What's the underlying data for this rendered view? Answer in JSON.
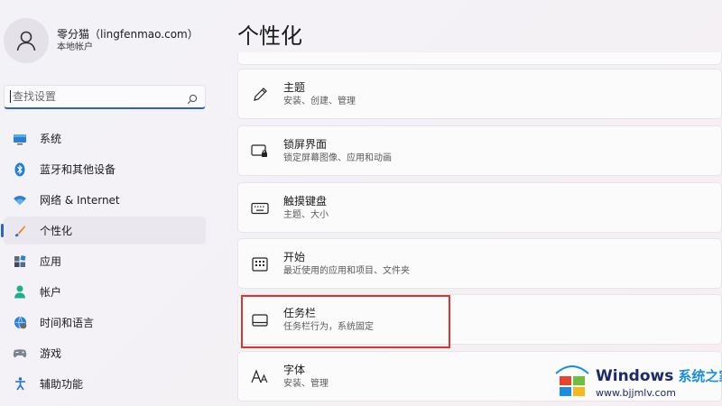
{
  "profile": {
    "name": "零分猫（lingfenmao.com）",
    "account_type": "本地帐户"
  },
  "search": {
    "placeholder": "查找设置"
  },
  "sidebar": {
    "items": [
      {
        "label": "系统",
        "icon": "monitor-icon"
      },
      {
        "label": "蓝牙和其他设备",
        "icon": "bluetooth-icon"
      },
      {
        "label": "网络 & Internet",
        "icon": "wifi-icon"
      },
      {
        "label": "个性化",
        "icon": "brush-icon",
        "active": true
      },
      {
        "label": "应用",
        "icon": "apps-icon"
      },
      {
        "label": "帐户",
        "icon": "person-icon"
      },
      {
        "label": "时间和语言",
        "icon": "globe-clock-icon"
      },
      {
        "label": "游戏",
        "icon": "gamepad-icon"
      },
      {
        "label": "辅助功能",
        "icon": "accessibility-icon"
      }
    ]
  },
  "page": {
    "title": "个性化"
  },
  "cards": [
    {
      "title": "主题",
      "subtitle": "安装、创建、管理",
      "icon": "pen-icon"
    },
    {
      "title": "锁屏界面",
      "subtitle": "锁定屏幕图像、应用和动画",
      "icon": "lock-screen-icon"
    },
    {
      "title": "触摸键盘",
      "subtitle": "主题、大小",
      "icon": "keyboard-icon"
    },
    {
      "title": "开始",
      "subtitle": "最近使用的应用和项目、文件夹",
      "icon": "start-menu-icon"
    },
    {
      "title": "任务栏",
      "subtitle": "任务栏行为，系统固定",
      "icon": "taskbar-icon",
      "highlighted": true
    },
    {
      "title": "字体",
      "subtitle": "安装、管理",
      "icon": "font-icon"
    }
  ],
  "watermark": {
    "brand": "Windows",
    "brand_cn": "系统之家",
    "url": "www.bjjmlv.com"
  },
  "colors": {
    "accent": "#2a63c6",
    "highlight_border": "#d9362e"
  }
}
